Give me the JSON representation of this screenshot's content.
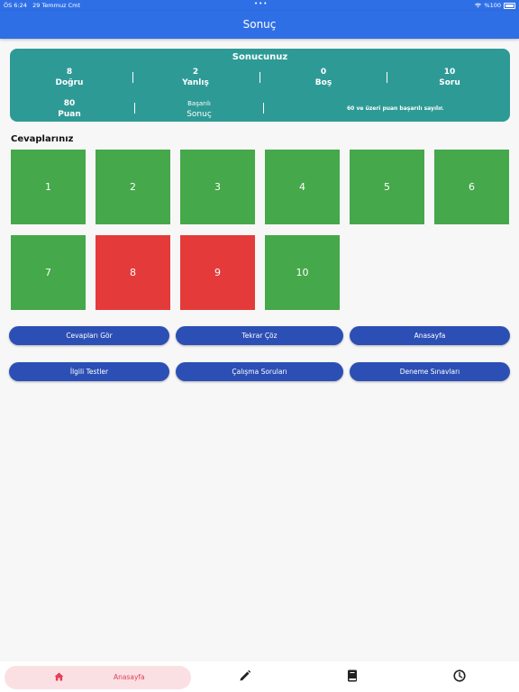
{
  "status_bar": {
    "time": "ÖS 6:24",
    "date": "29 Temmuz Cmt",
    "battery": "%100"
  },
  "header": {
    "title": "Sonuç"
  },
  "result": {
    "title": "Sonucunuz",
    "correct": {
      "value": "8",
      "label": "Doğru"
    },
    "wrong": {
      "value": "2",
      "label": "Yanlış"
    },
    "empty": {
      "value": "0",
      "label": "Boş"
    },
    "total": {
      "value": "10",
      "label": "Soru"
    },
    "score": {
      "value": "80",
      "label": "Puan"
    },
    "outcome": {
      "value": "Başarılı",
      "label": "Sonuç"
    },
    "note": "60 ve üzeri puan başarılı sayılır."
  },
  "answers": {
    "title": "Cevaplarınız",
    "items": [
      {
        "label": "1",
        "status": "correct"
      },
      {
        "label": "2",
        "status": "correct"
      },
      {
        "label": "3",
        "status": "correct"
      },
      {
        "label": "4",
        "status": "correct"
      },
      {
        "label": "5",
        "status": "correct"
      },
      {
        "label": "6",
        "status": "correct"
      },
      {
        "label": "7",
        "status": "correct"
      },
      {
        "label": "8",
        "status": "wrong"
      },
      {
        "label": "9",
        "status": "wrong"
      },
      {
        "label": "10",
        "status": "correct"
      }
    ]
  },
  "buttons": {
    "show_answers": "Cevapları Gör",
    "retry": "Tekrar Çöz",
    "home": "Anasayfa",
    "related_tests": "İlgili Testler",
    "study_questions": "Çalışma Soruları",
    "practice_exams": "Deneme Sınavları"
  },
  "tabbar": {
    "home_label": "Anasayfa",
    "icons": [
      "home-icon",
      "pencil-icon",
      "book-icon",
      "clock-icon"
    ]
  },
  "colors": {
    "primary": "#2f6fe6",
    "card": "#2e9a96",
    "correct": "#45a84a",
    "wrong": "#e53a3a",
    "button": "#2c4fb5",
    "tab_active_bg": "#fbe0e3",
    "tab_active_fg": "#e0405a"
  }
}
